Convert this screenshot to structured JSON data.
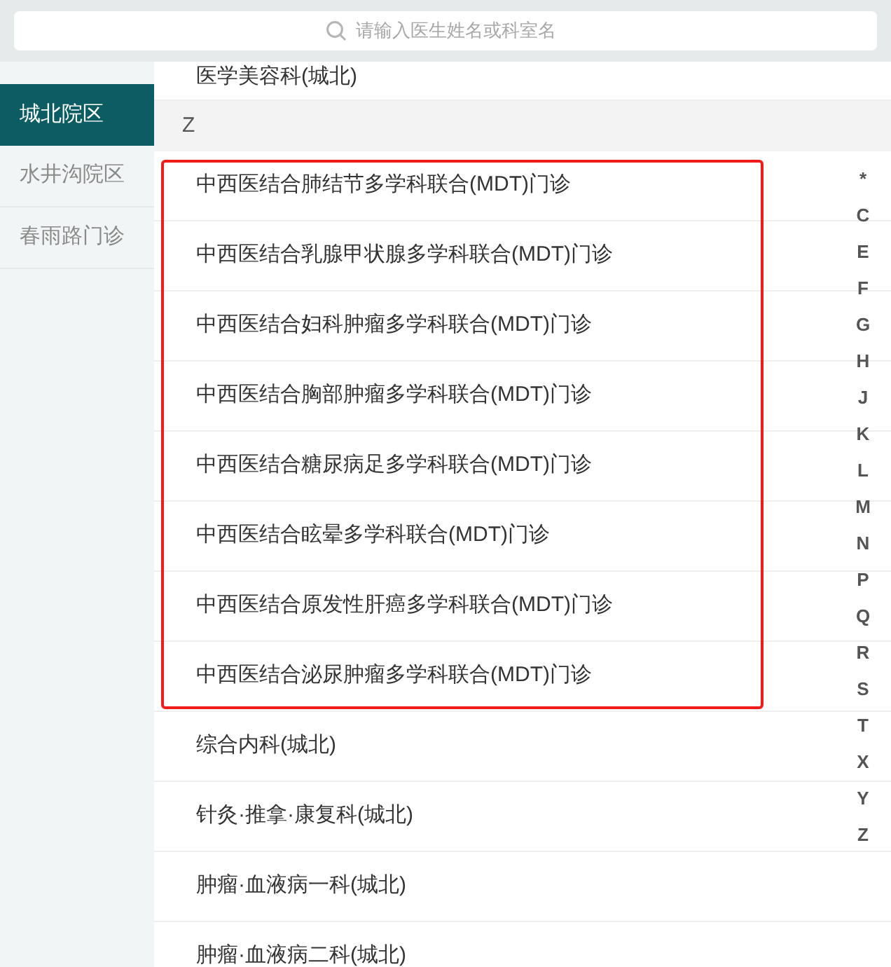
{
  "search": {
    "placeholder": "请输入医生姓名或科室名"
  },
  "campuses": [
    {
      "label": "城北院区",
      "selected": true
    },
    {
      "label": "水井沟院区",
      "selected": false
    },
    {
      "label": "春雨路门诊",
      "selected": false
    }
  ],
  "departments": [
    {
      "kind": "item",
      "text": "医学美容科(城北)"
    },
    {
      "kind": "header",
      "text": "Z"
    },
    {
      "kind": "group",
      "highlighted": true,
      "items": [
        "中西医结合肺结节多学科联合(MDT)门诊",
        "中西医结合乳腺甲状腺多学科联合(MDT)门诊",
        "中西医结合妇科肿瘤多学科联合(MDT)门诊",
        "中西医结合胸部肿瘤多学科联合(MDT)门诊",
        "中西医结合糖尿病足多学科联合(MDT)门诊",
        "中西医结合眩晕多学科联合(MDT)门诊",
        "中西医结合原发性肝癌多学科联合(MDT)门诊",
        "中西医结合泌尿肿瘤多学科联合(MDT)门诊"
      ]
    },
    {
      "kind": "item",
      "text": "综合内科(城北)"
    },
    {
      "kind": "item",
      "text": "针灸·推拿·康复科(城北)"
    },
    {
      "kind": "item",
      "text": "肿瘤·血液病一科(城北)"
    },
    {
      "kind": "item",
      "text": "肿瘤·血液病二科(城北)"
    }
  ],
  "index_letters": [
    "*",
    "C",
    "E",
    "F",
    "G",
    "H",
    "J",
    "K",
    "L",
    "M",
    "N",
    "P",
    "Q",
    "R",
    "S",
    "T",
    "X",
    "Y",
    "Z"
  ]
}
